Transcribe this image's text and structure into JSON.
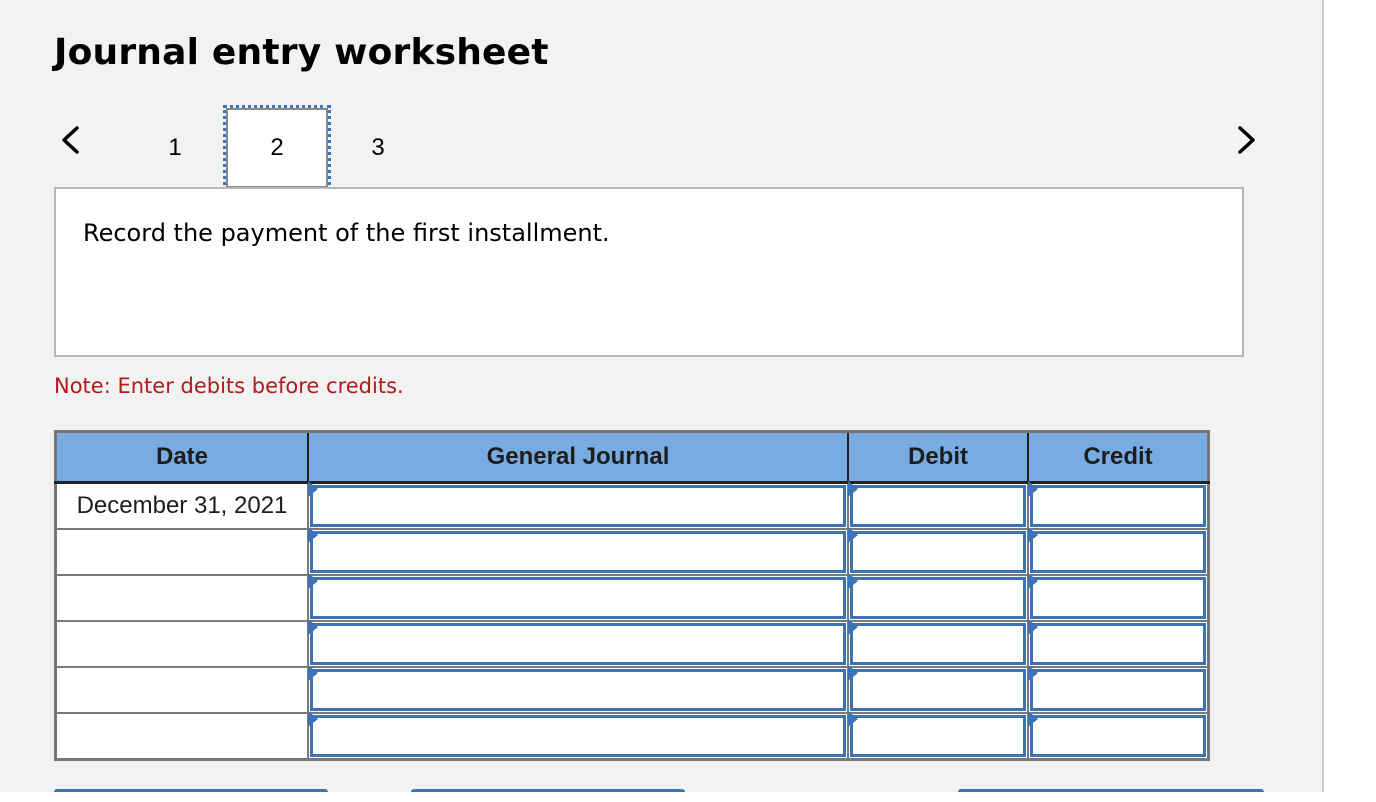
{
  "header": {
    "title": "Journal entry worksheet"
  },
  "navigation": {
    "prev_icon": "chevron-left-icon",
    "next_icon": "chevron-right-icon",
    "steps": [
      {
        "label": "1",
        "selected": false
      },
      {
        "label": "2",
        "selected": true
      },
      {
        "label": "3",
        "selected": false
      }
    ]
  },
  "instruction": {
    "text": "Record the payment of the first installment."
  },
  "note": {
    "text": "Note: Enter debits before credits.",
    "color": "#b01c1c"
  },
  "table": {
    "columns": [
      "Date",
      "General Journal",
      "Debit",
      "Credit"
    ],
    "rows": [
      {
        "date": "December 31, 2021",
        "general_journal": "",
        "debit": "",
        "credit": ""
      },
      {
        "date": "",
        "general_journal": "",
        "debit": "",
        "credit": ""
      },
      {
        "date": "",
        "general_journal": "",
        "debit": "",
        "credit": ""
      },
      {
        "date": "",
        "general_journal": "",
        "debit": "",
        "credit": ""
      },
      {
        "date": "",
        "general_journal": "",
        "debit": "",
        "credit": ""
      },
      {
        "date": "",
        "general_journal": "",
        "debit": "",
        "credit": ""
      }
    ],
    "header_color": "#78abe2",
    "input_border_color": "#3b73b5"
  }
}
